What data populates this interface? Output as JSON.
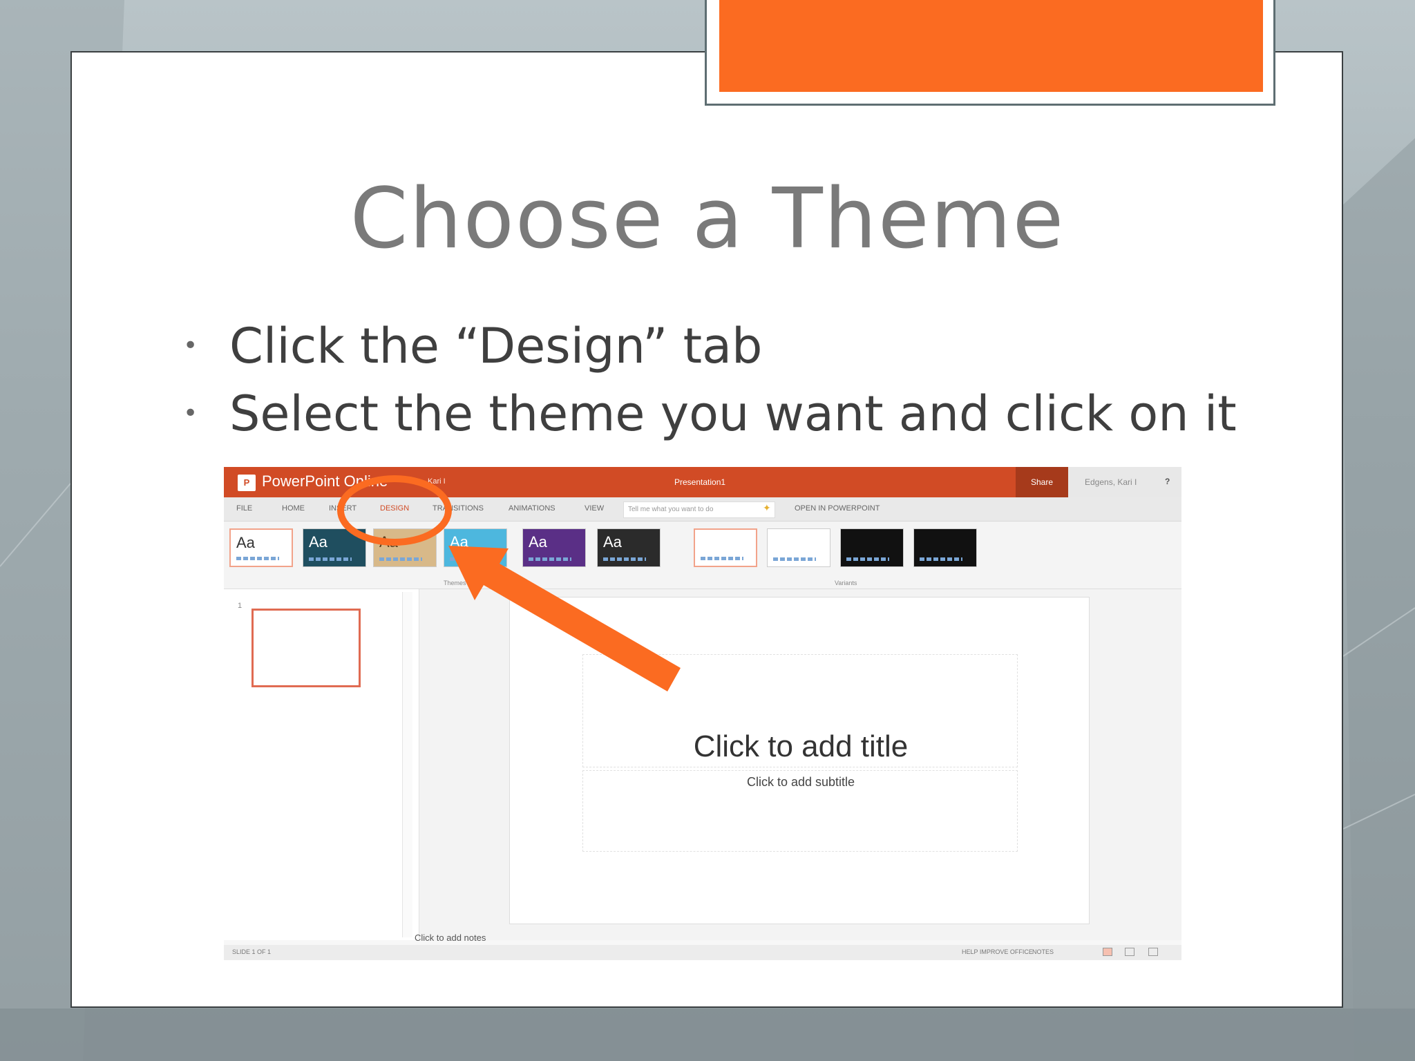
{
  "slide": {
    "title": "Choose a Theme",
    "bullets": [
      "Click the “Design” tab",
      "Select the theme you want and click on it"
    ],
    "accent_color": "#fb6b21"
  },
  "screenshot": {
    "app_name": "PowerPoint Online",
    "logo_letter": "P",
    "user_short": "Kari I",
    "doc_title": "Presentation1",
    "share_label": "Share",
    "account_name": "Edgens, Kari I",
    "help_label": "?",
    "tabs": [
      "FILE",
      "HOME",
      "INSERT",
      "DESIGN",
      "TRANSITIONS",
      "ANIMATIONS",
      "VIEW"
    ],
    "active_tab": "DESIGN",
    "tell_me_placeholder": "Tell me what you want to do",
    "open_in_label": "OPEN IN POWERPOINT",
    "themes_label": "Themes",
    "variants_label": "Variants",
    "theme_sample_text": "Aa",
    "slide_number": "1",
    "title_placeholder": "Click to add title",
    "subtitle_placeholder": "Click to add subtitle",
    "notes_placeholder": "Click to add notes",
    "status_slide": "SLIDE 1 OF 1",
    "status_help": "HELP IMPROVE OFFICE",
    "status_notes": "NOTES",
    "chrome_color": "#d14b25"
  },
  "annotation": {
    "color": "#fb6b21",
    "shapes": [
      "circle around DESIGN tab",
      "arrow pointing to theme gallery"
    ]
  }
}
